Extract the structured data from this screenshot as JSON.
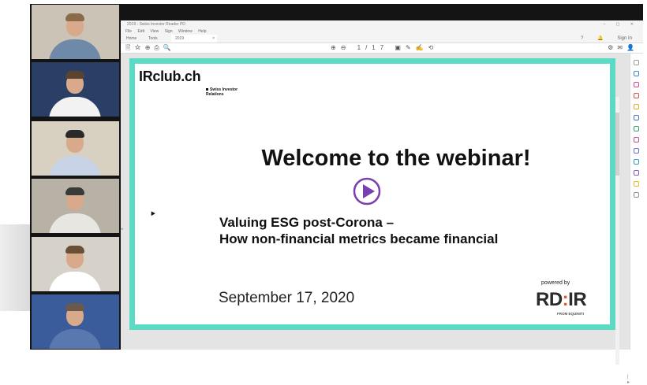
{
  "viewer": {
    "title": "2019 - Swiss Investor Reader PD",
    "window_controls": "– ▢ ✕",
    "menu": [
      "File",
      "Edit",
      "View",
      "Sign",
      "Window",
      "Help"
    ],
    "tabs": [
      "Home",
      "Tools"
    ],
    "document_tab": "2019",
    "sign_in": "Sign In",
    "help_icon": "?",
    "bell_icon": "🔔",
    "toolbar_left": "🖹☆⊕⎙🔍",
    "toolbar_center": "⊕⊖ 1/17 ▣✎✍⟲",
    "toolbar_right": "⚙✉👤"
  },
  "slide": {
    "logo": "IRclub.ch",
    "logo_sub_line1": "Swiss Investor",
    "logo_sub_line2": "Relations",
    "headline": "Welcome to the webinar!",
    "subtitle_line1": "Valuing ESG post-Corona –",
    "subtitle_line2": "How non-financial metrics became financial",
    "date": "September 17, 2020",
    "powered_by": "powered by",
    "sponsor_left": "RD",
    "sponsor_colon": ":",
    "sponsor_right": "IR",
    "sponsor_from": "FROM EQUINITI",
    "accent_color": "#5bdbc3",
    "play_color": "#7a3fb0"
  },
  "participants": [
    {
      "name": "participant-1",
      "wall": "#cbc4b6",
      "shirt": "#6f8aa8",
      "hair": "#8a6a48"
    },
    {
      "name": "participant-2",
      "wall": "#2a3f66",
      "shirt": "#f2f2f2",
      "hair": "#5a4330"
    },
    {
      "name": "participant-3",
      "wall": "#d8d0c0",
      "shirt": "#c8d4e6",
      "hair": "#2a2a2a"
    },
    {
      "name": "participant-4",
      "wall": "#b8b2a6",
      "shirt": "#e8e6e0",
      "hair": "#3a3a3a"
    },
    {
      "name": "participant-5",
      "wall": "#d6d2ca",
      "shirt": "#ffffff",
      "hair": "#6a5036"
    },
    {
      "name": "participant-6",
      "wall": "#3a5c9a",
      "shirt": "#5a78b0",
      "hair": "#6a5a4a"
    }
  ]
}
